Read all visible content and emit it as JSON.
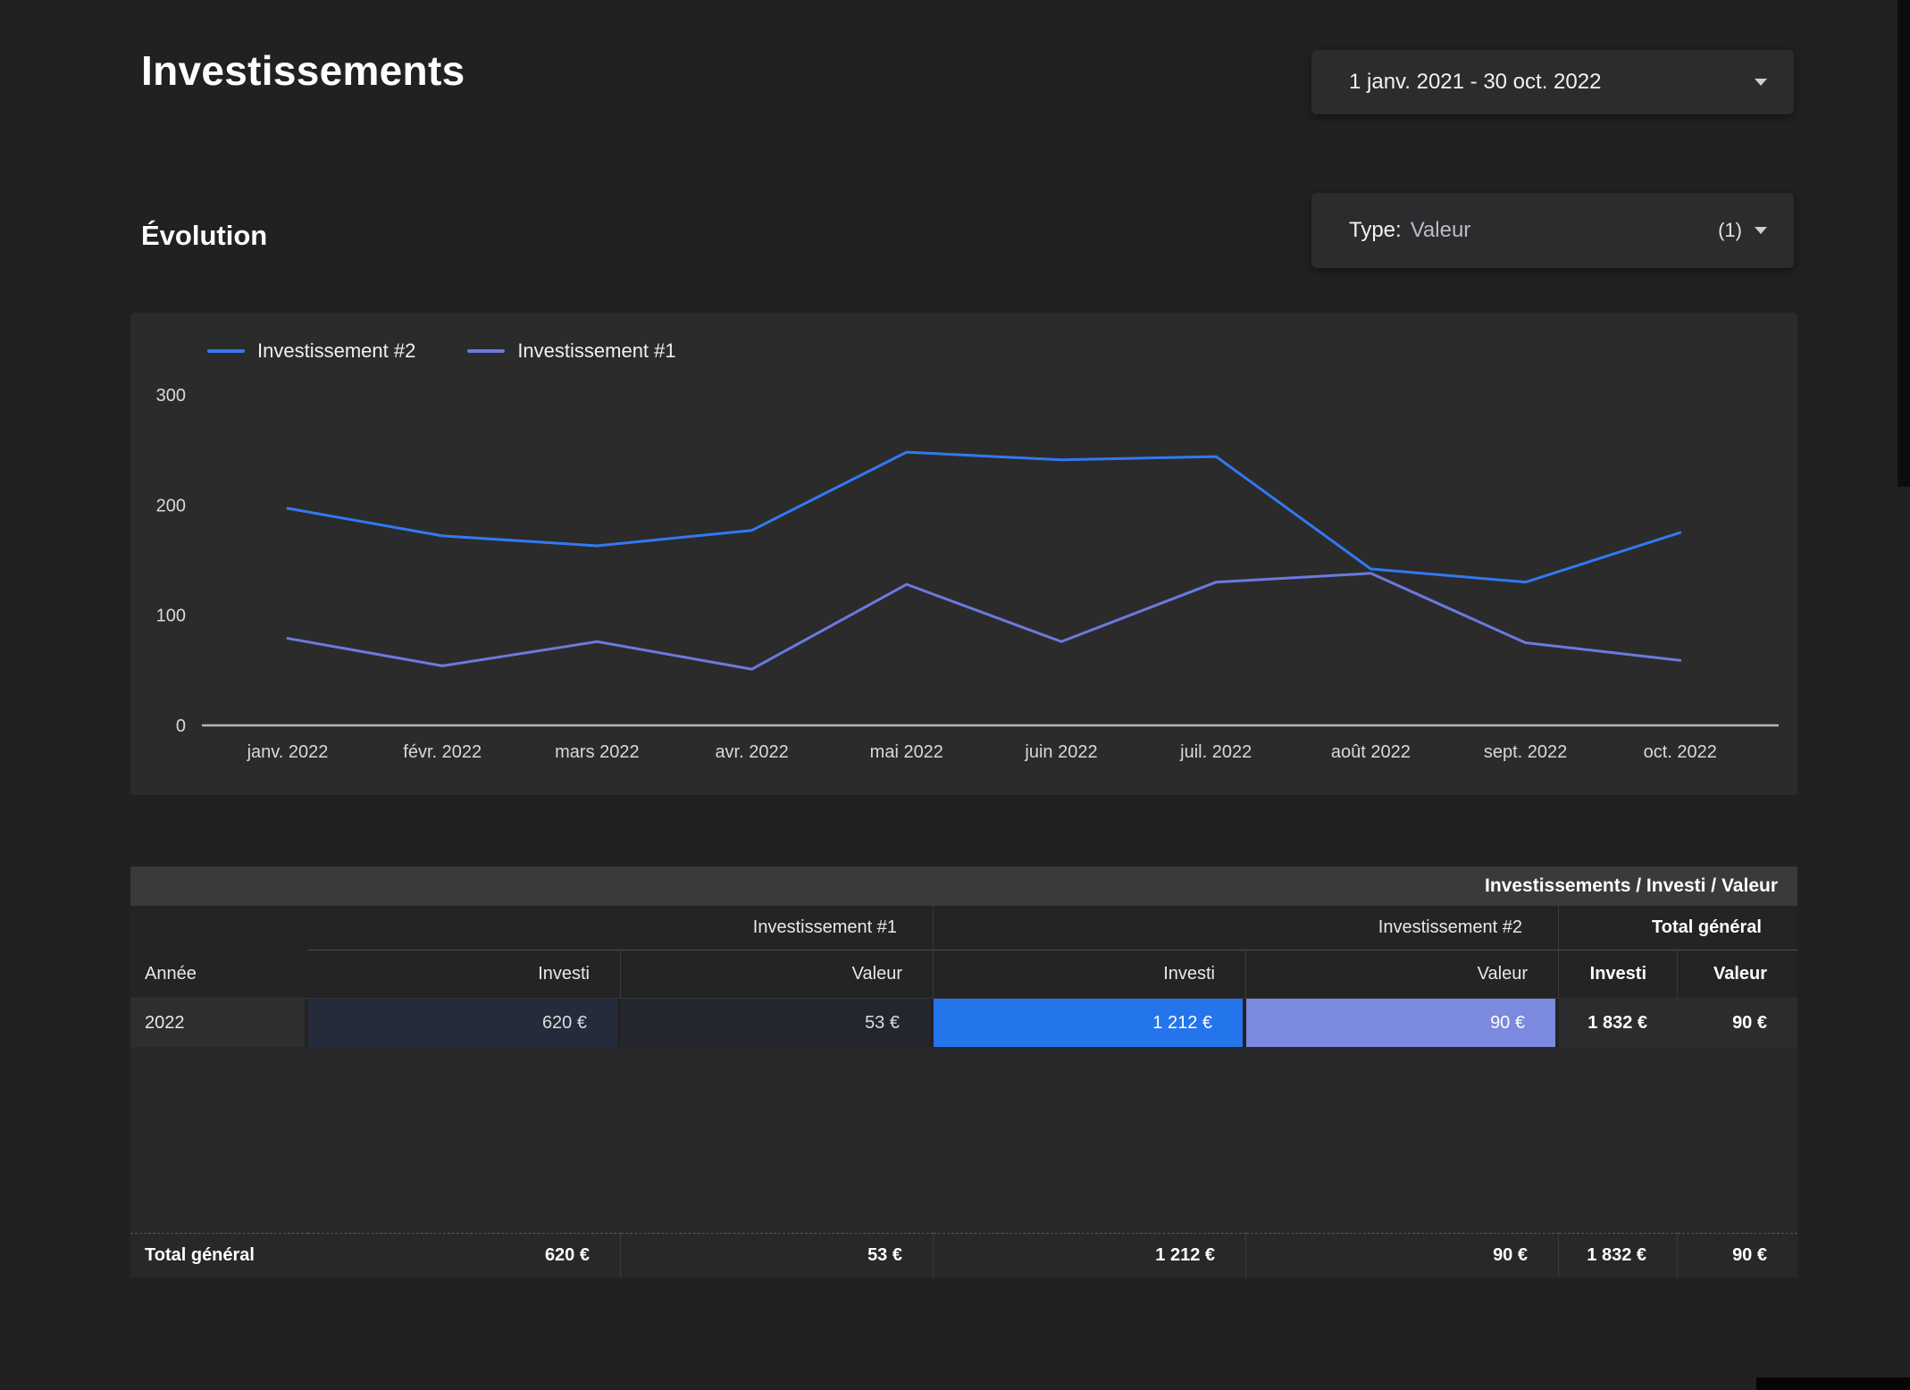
{
  "page": {
    "title": "Investissements"
  },
  "controls": {
    "date_range": {
      "value": "1 janv. 2021 - 30 oct. 2022"
    },
    "type_filter": {
      "label": "Type:",
      "value": "Valeur",
      "count": "(1)"
    }
  },
  "section": {
    "title": "Évolution"
  },
  "chart_data": {
    "type": "line",
    "title": "Évolution",
    "x": [
      "janv. 2022",
      "févr. 2022",
      "mars 2022",
      "avr. 2022",
      "mai 2022",
      "juin 2022",
      "juil. 2022",
      "août 2022",
      "sept. 2022",
      "oct. 2022"
    ],
    "series": [
      {
        "name": "Investissement #2",
        "color": "#3279f1",
        "values": [
          197,
          172,
          163,
          177,
          248,
          241,
          244,
          142,
          130,
          175
        ]
      },
      {
        "name": "Investissement #1",
        "color": "#6b7ade",
        "values": [
          79,
          54,
          76,
          51,
          128,
          76,
          130,
          138,
          75,
          59
        ]
      }
    ],
    "ylim": [
      0,
      300
    ],
    "yticks": [
      0,
      100,
      200,
      300
    ],
    "grid": false,
    "legend_position": "top-left",
    "axis_color": "#b0b5ba"
  },
  "table": {
    "title": "Investissements / Investi / Valeur",
    "groups": [
      "Investissement #1",
      "Investissement #2",
      "Total général"
    ],
    "columns": [
      "Année",
      "Investi",
      "Valeur",
      "Investi",
      "Valeur",
      "Investi",
      "Valeur"
    ],
    "rows": [
      {
        "label": "2022",
        "values": [
          "620 €",
          "53 €",
          "1 212 €",
          "90 €",
          "1 832 €",
          "90 €"
        ]
      }
    ],
    "footer": {
      "label": "Total général",
      "values": [
        "620 €",
        "53 €",
        "1 212 €",
        "90 €",
        "1 832 €",
        "90 €"
      ]
    },
    "cell_colors": {
      "investi_1": "#252b3a",
      "valeur_1": "#24262f",
      "investi_2": "#2474ec",
      "valeur_2": "#7b89de"
    }
  }
}
